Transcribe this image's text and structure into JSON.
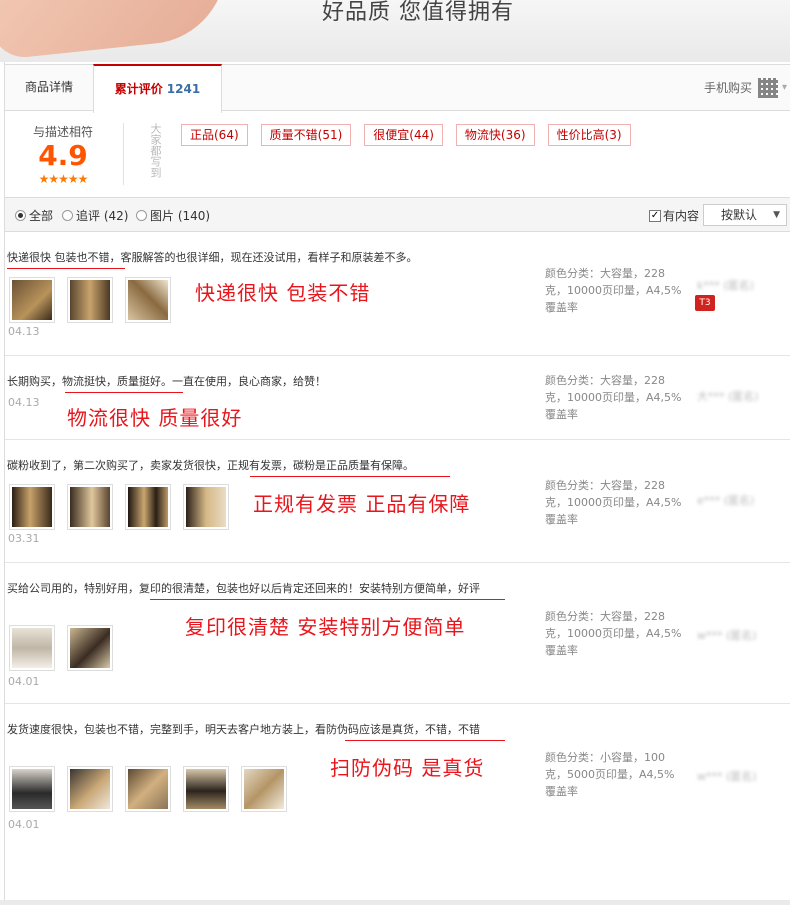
{
  "banner": {
    "slogan": "好品质 您值得拥有"
  },
  "tabs": [
    {
      "label": "商品详情"
    },
    {
      "label": "累计评价",
      "count": "1241"
    }
  ],
  "mobile_buy": {
    "label": "手机购买",
    "icon": "qr-code-icon"
  },
  "summary": {
    "score_label": "与描述相符",
    "score": "4.9",
    "stars": "★★★★★",
    "vertical_text": "大家都写到",
    "tags": [
      "正品(64)",
      "质量不错(51)",
      "很便宜(44)",
      "物流快(36)",
      "性价比高(3)"
    ]
  },
  "filters": {
    "all": "全部",
    "follow": "追评 (42)",
    "pictures": "图片 (140)",
    "has_content": "有内容",
    "sort": "按默认"
  },
  "reviews": [
    {
      "text": "快递很快 包装也不错，客服解答的也很详细，现在还没试用，看样子和原装差不多。",
      "date": "04.13",
      "sku": "颜色分类：大容量，228克，10000页印量，A4,5%覆盖率",
      "user": "k*** (匿名)",
      "badge": "T3",
      "highlight": "快递很快   包装不错",
      "thumbs": 3
    },
    {
      "text": "长期购买，物流挺快，质量挺好。一直在使用，良心商家，给赞！",
      "date": "04.13",
      "sku": "颜色分类：大容量，228克，10000页印量，A4,5%覆盖率",
      "user": "大*** (匿名)",
      "highlight": "物流很快   质量很好",
      "thumbs": 0
    },
    {
      "text": "碳粉收到了，第二次购买了，卖家发货很快，正规有发票，碳粉是正品质量有保障。",
      "date": "03.31",
      "sku": "颜色分类：大容量，228克，10000页印量，A4,5%覆盖率",
      "user": "e*** (匿名)",
      "highlight": "正规有发票  正品有保障",
      "thumbs": 4
    },
    {
      "text": "买给公司用的，特别好用，复印的很清楚，包装也好以后肯定还回来的！安装特别方便简单，好评",
      "date": "04.01",
      "sku": "颜色分类：大容量，228克，10000页印量，A4,5%覆盖率",
      "user": "w*** (匿名)",
      "highlight": "复印很清楚   安装特别方便简单",
      "thumbs": 2
    },
    {
      "text": "发货速度很快，包装也不错，完整到手，明天去客户地方装上，看防伪码应该是真货，不错，不错",
      "date": "04.01",
      "sku": "颜色分类：小容量，100克，5000页印量，A4,5%覆盖率",
      "user": "w*** (匿名)",
      "highlight": "扫防伪码   是真货",
      "thumbs": 5
    }
  ],
  "colors": {
    "accent": "#c40000",
    "highlight": "#e8161c",
    "score": "#ff5500"
  }
}
